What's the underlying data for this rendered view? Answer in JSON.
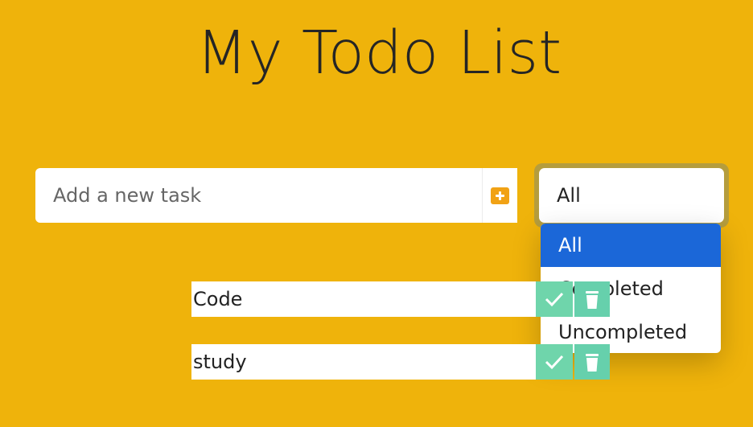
{
  "page_title": "My Todo List",
  "task_input": {
    "value": "",
    "placeholder": "Add a new task"
  },
  "add_button": {
    "icon": "plus-icon",
    "accent_color": "#f1a215"
  },
  "filter": {
    "selected": "All",
    "options": [
      {
        "label": "All",
        "selected": true
      },
      {
        "label": "Completed",
        "selected": false
      },
      {
        "label": "Uncompleted",
        "selected": false
      }
    ]
  },
  "todos": [
    {
      "text": "Code",
      "complete_icon": "check-icon",
      "delete_icon": "trash-icon"
    },
    {
      "text": "study",
      "complete_icon": "check-icon",
      "delete_icon": "trash-icon"
    }
  ],
  "colors": {
    "background": "#efb30b",
    "selected_option": "#1b67d8",
    "action_buttons": "#6fd5ab"
  }
}
